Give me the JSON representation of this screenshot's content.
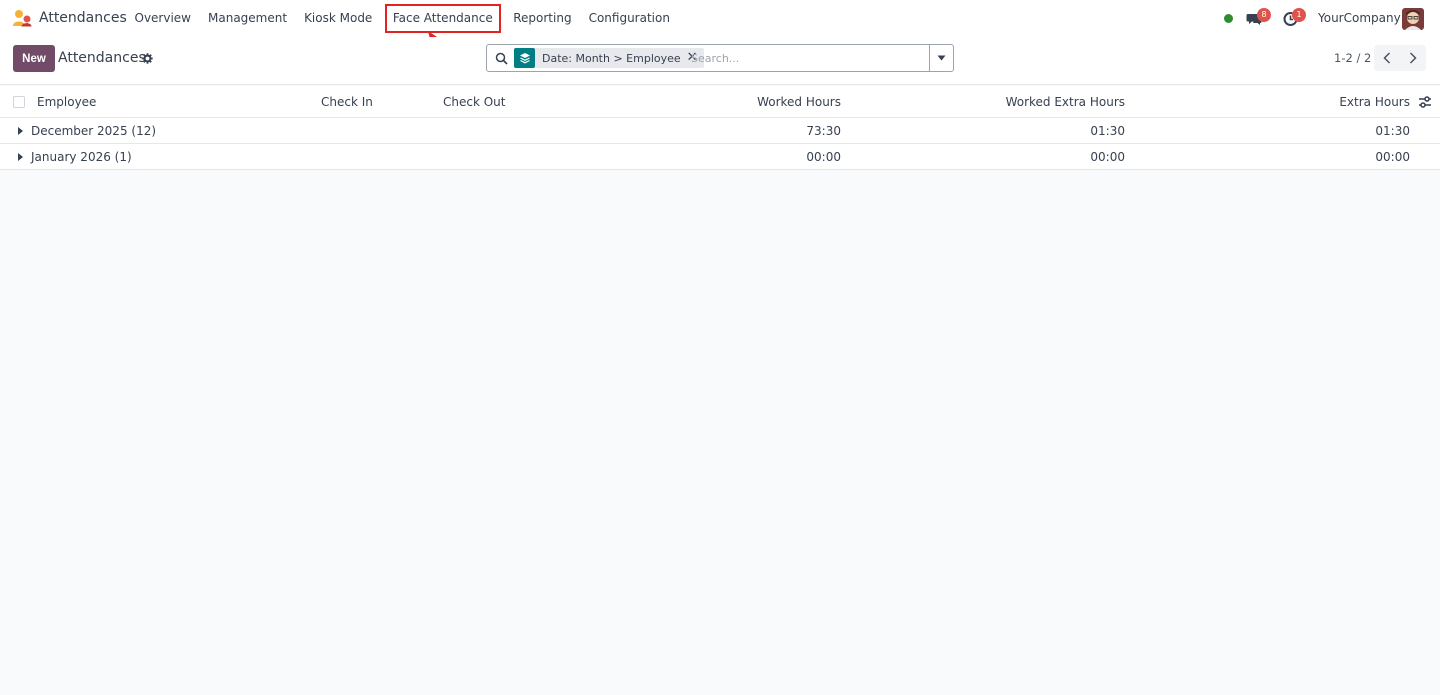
{
  "navbar": {
    "app_name": "Attendances",
    "menu": [
      {
        "label": "Overview"
      },
      {
        "label": "Management"
      },
      {
        "label": "Kiosk Mode"
      },
      {
        "label": "Face Attendance"
      },
      {
        "label": "Reporting"
      },
      {
        "label": "Configuration"
      }
    ],
    "highlighted_item": "Face Attendance",
    "messages_badge": "8",
    "activities_badge": "1",
    "company": "YourCompany",
    "status_color": "#2e8b2e"
  },
  "control_panel": {
    "new_label": "New",
    "title": "Attendances",
    "search": {
      "facet_label": "Date: Month > Employee",
      "placeholder": "Search..."
    },
    "pager": "1-2 / 2"
  },
  "table": {
    "columns": [
      "Employee",
      "Check In",
      "Check Out",
      "Worked Hours",
      "Worked Extra Hours",
      "Extra Hours"
    ],
    "groups": [
      {
        "label": "December 2025 (12)",
        "worked_hours": "73:30",
        "worked_extra_hours": "01:30",
        "extra_hours": "01:30"
      },
      {
        "label": "January 2026 (1)",
        "worked_hours": "00:00",
        "worked_extra_hours": "00:00",
        "extra_hours": "00:00"
      }
    ]
  },
  "colors": {
    "brand": "#714b67",
    "facet": "#017e84",
    "highlight": "#e02424",
    "badge": "#e0534a"
  }
}
